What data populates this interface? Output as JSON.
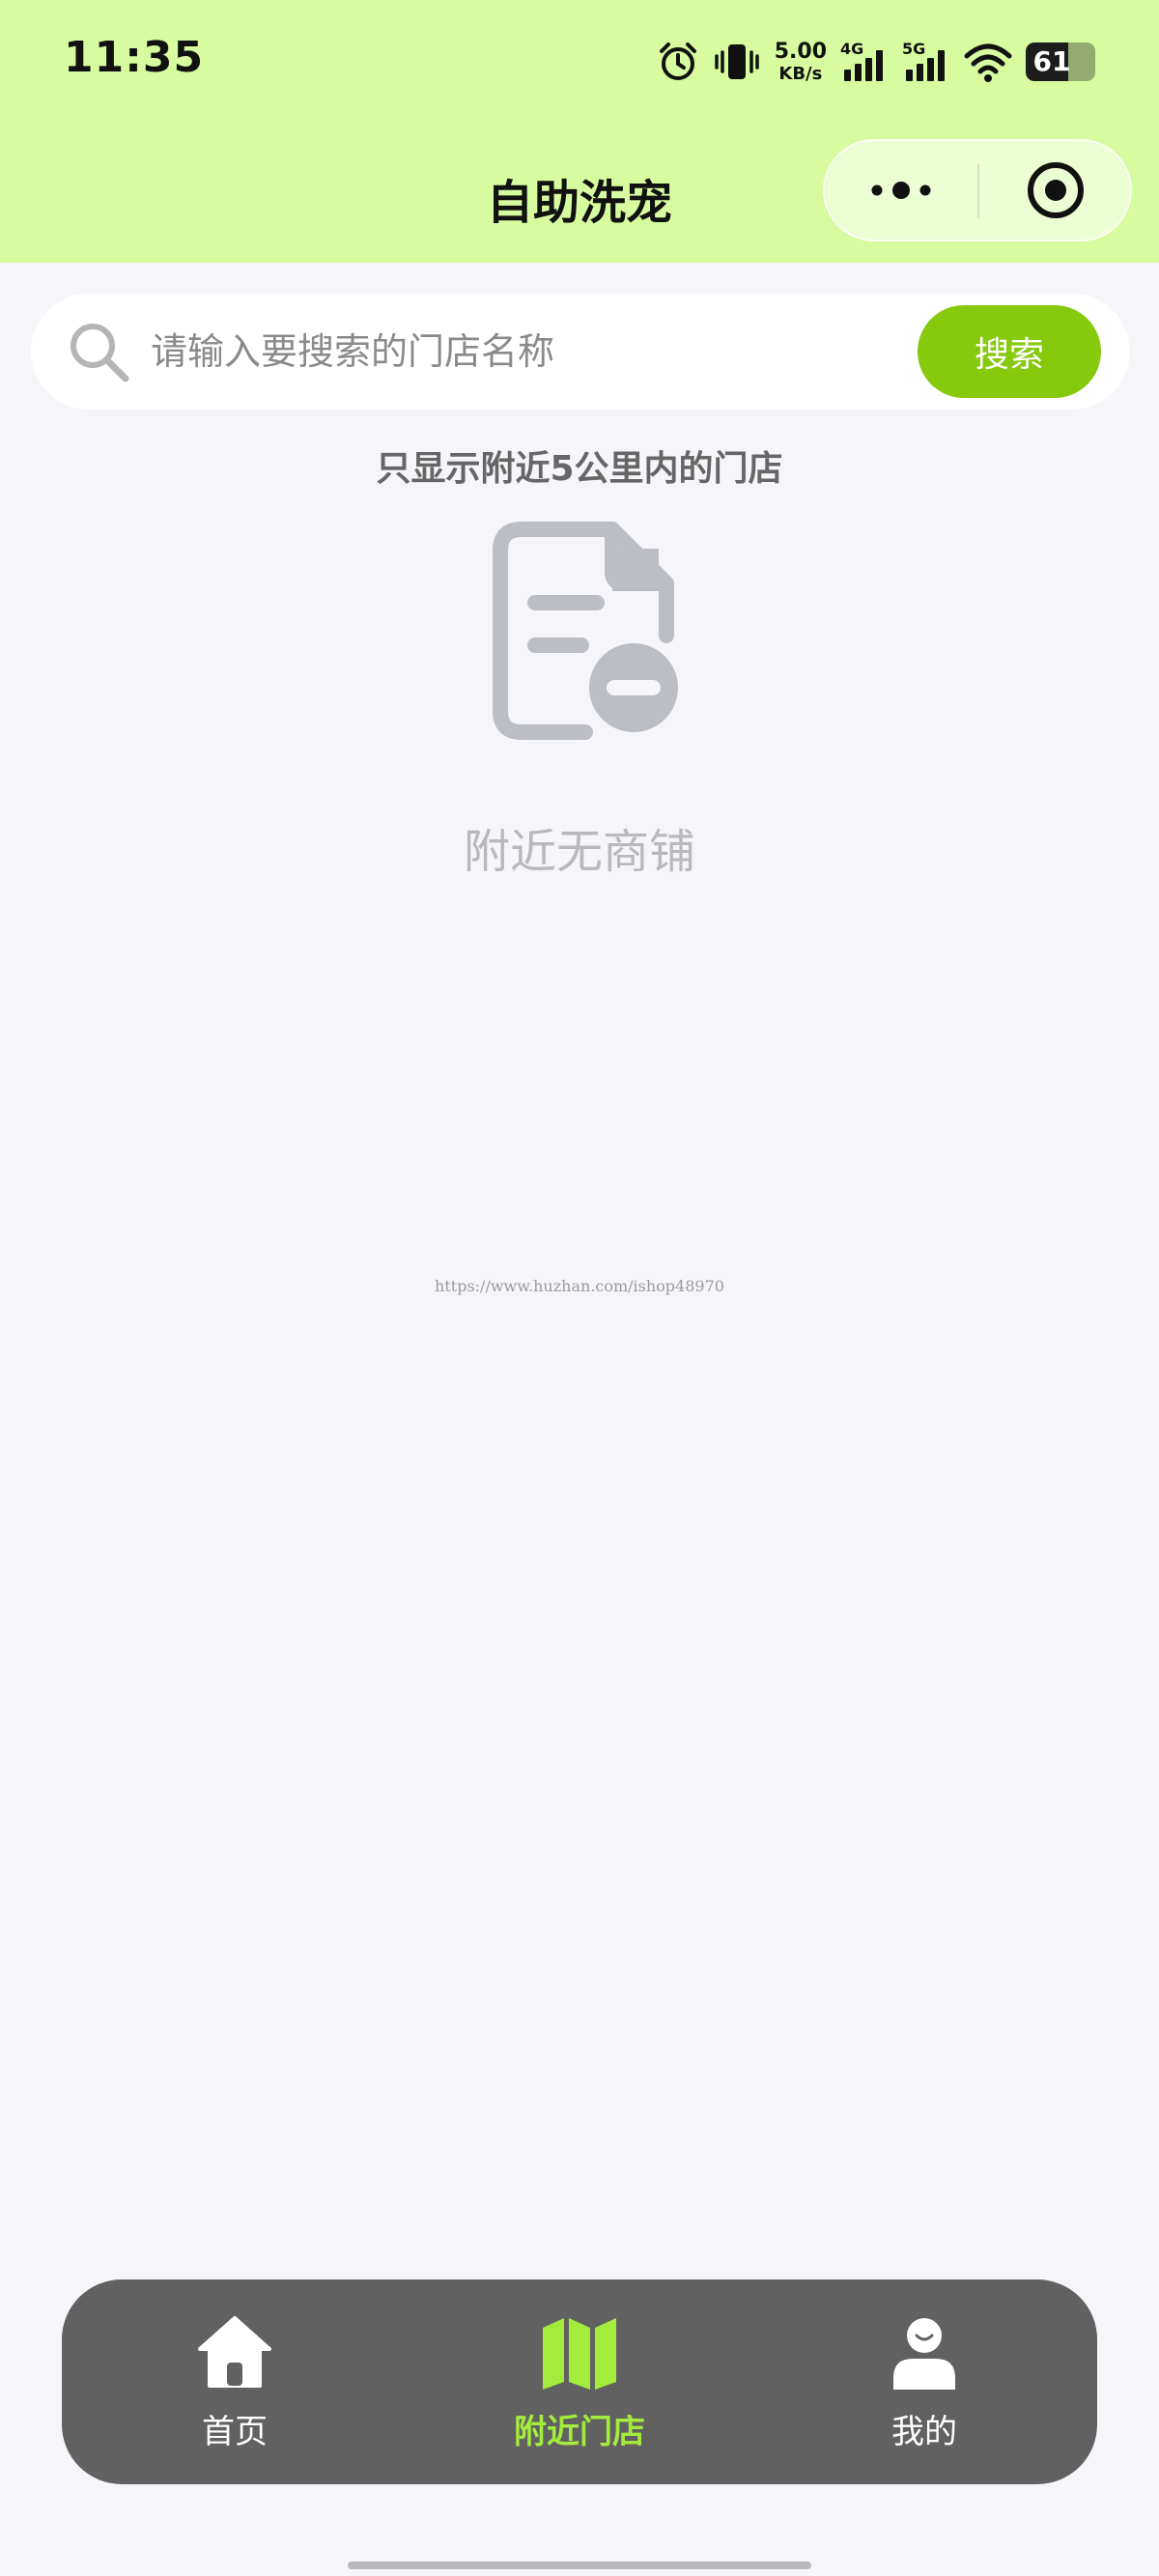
{
  "status_bar": {
    "time": "11:35",
    "net_speed_value": "5.00",
    "net_speed_unit": "KB/s",
    "cell1_label": "4G",
    "cell2_label": "5G",
    "battery": "61",
    "battery_level": 0.61
  },
  "nav": {
    "title": "自助洗宠"
  },
  "search": {
    "placeholder": "请输入要搜索的门店名称",
    "value": "",
    "button_label": "搜索"
  },
  "range_hint": "只显示附近5公里内的门店",
  "empty_state": {
    "text": "附近无商铺"
  },
  "watermark": "https://www.huzhan.com/ishop48970",
  "tab_bar": {
    "items": [
      {
        "label": "首页",
        "icon": "home-icon",
        "active": false
      },
      {
        "label": "附近门店",
        "icon": "map-icon",
        "active": true
      },
      {
        "label": "我的",
        "icon": "user-icon",
        "active": false
      }
    ]
  },
  "colors": {
    "header_bg": "#d6fc9f",
    "accent": "#86c90d",
    "tab_active": "#a4ec3b",
    "tab_bar_bg": "#616162",
    "page_bg": "#f5f5fa"
  }
}
